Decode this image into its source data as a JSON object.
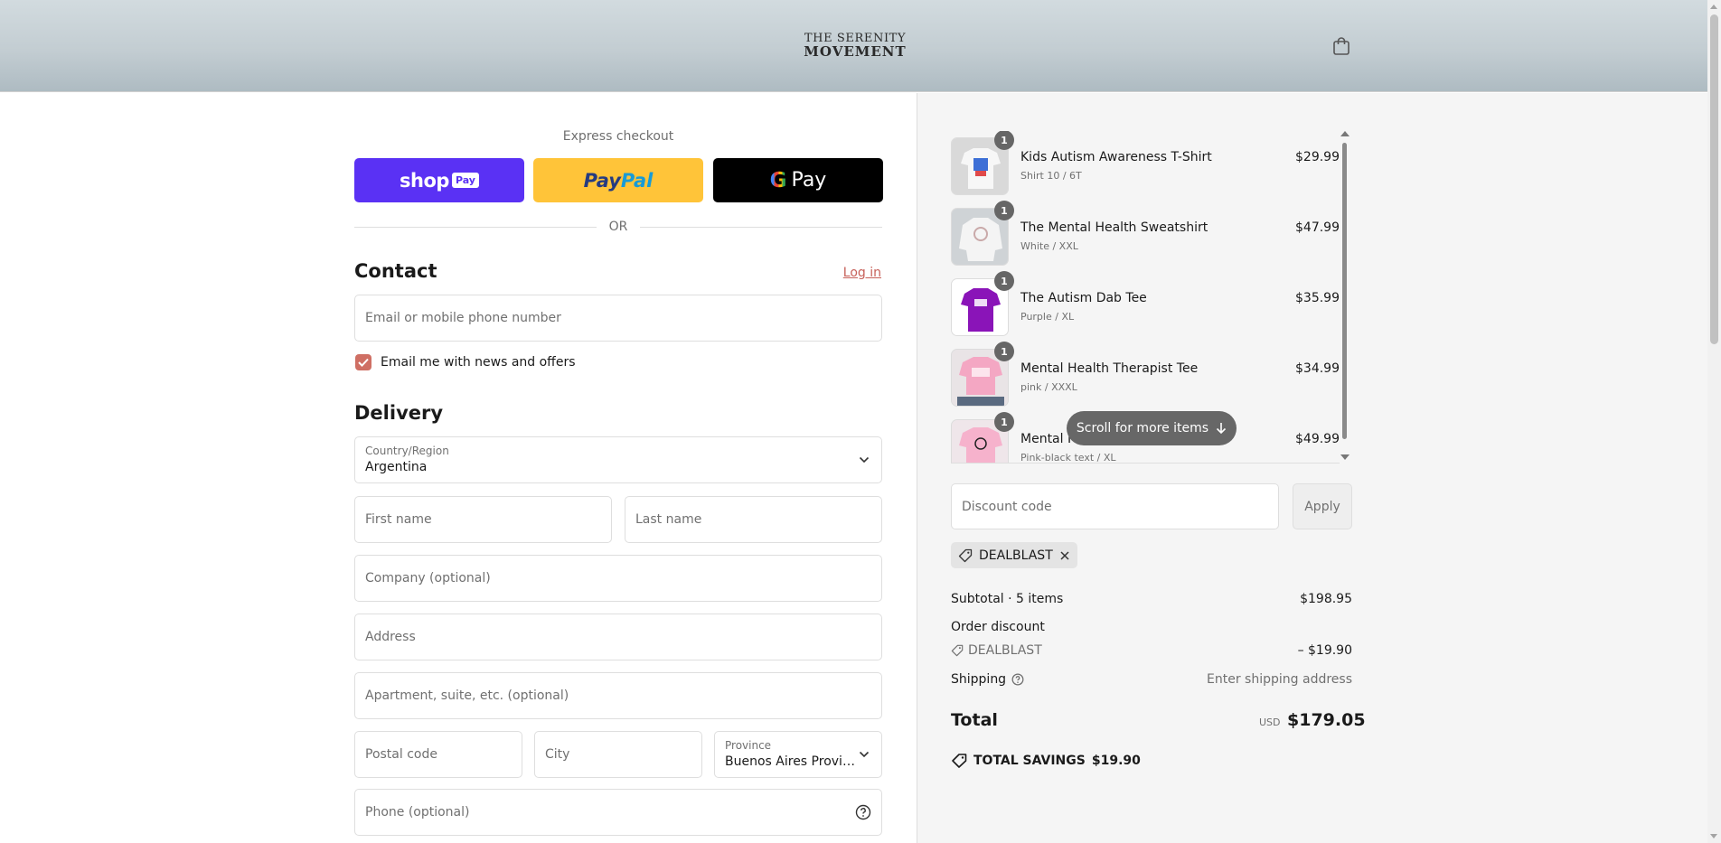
{
  "header": {
    "logo_line1": "THE SERENITY",
    "logo_line2": "MOVEMENT",
    "cart_icon": "shopping-bag-icon"
  },
  "express": {
    "title": "Express checkout",
    "shop_pay": {
      "shop": "shop",
      "pay": "Pay"
    },
    "paypal": {
      "part1": "Pay",
      "part2": "Pal"
    },
    "gpay": {
      "g": "G",
      "pay": "Pay"
    },
    "or": "OR"
  },
  "contact": {
    "title": "Contact",
    "login": "Log in",
    "email_placeholder": "Email or mobile phone number",
    "newsletter_label": "Email me with news and offers",
    "newsletter_checked": true
  },
  "delivery": {
    "title": "Delivery",
    "country_label": "Country/Region",
    "country_value": "Argentina",
    "first_name_placeholder": "First name",
    "last_name_placeholder": "Last name",
    "company_placeholder": "Company (optional)",
    "address_placeholder": "Address",
    "apartment_placeholder": "Apartment, suite, etc. (optional)",
    "postal_placeholder": "Postal code",
    "city_placeholder": "City",
    "province_label": "Province",
    "province_value": "Buenos Aires Provin...",
    "phone_placeholder": "Phone (optional)"
  },
  "cart": {
    "items": [
      {
        "name": "Kids Autism Awareness T-Shirt",
        "variant": "Shirt 10 / 6T",
        "price": "$29.99",
        "qty": "1",
        "thumb_color": "#f2f2f2"
      },
      {
        "name": "The Mental Health Sweatshirt",
        "variant": "White / XXL",
        "price": "$47.99",
        "qty": "1",
        "thumb_color": "#ededed"
      },
      {
        "name": "The Autism Dab Tee",
        "variant": "Purple / XL",
        "price": "$35.99",
        "qty": "1",
        "thumb_color": "#8a14b8"
      },
      {
        "name": "Mental Health Therapist Tee",
        "variant": "pink / XXXL",
        "price": "$34.99",
        "qty": "1",
        "thumb_color": "#f4a7c3"
      },
      {
        "name": "Mental F",
        "variant": "Pink-black text / XL",
        "price": "$49.99",
        "qty": "1",
        "thumb_color": "#f6b2cc"
      }
    ],
    "scroll_hint": "Scroll for more items"
  },
  "discount": {
    "placeholder": "Discount code",
    "apply": "Apply",
    "applied_code": "DEALBLAST"
  },
  "summary": {
    "subtotal_label": "Subtotal · 5 items",
    "subtotal_value": "$198.95",
    "order_discount_label": "Order discount",
    "discount_code": "DEALBLAST",
    "discount_value": "– $19.90",
    "shipping_label": "Shipping",
    "shipping_value": "Enter shipping address",
    "total_label": "Total",
    "currency": "USD",
    "total_value": "$179.05",
    "savings_label": "TOTAL SAVINGS",
    "savings_value": "$19.90"
  },
  "colors": {
    "accent": "#cf6f64",
    "shop_pay": "#5a31f4",
    "paypal": "#ffc439",
    "gpay": "#000000"
  }
}
